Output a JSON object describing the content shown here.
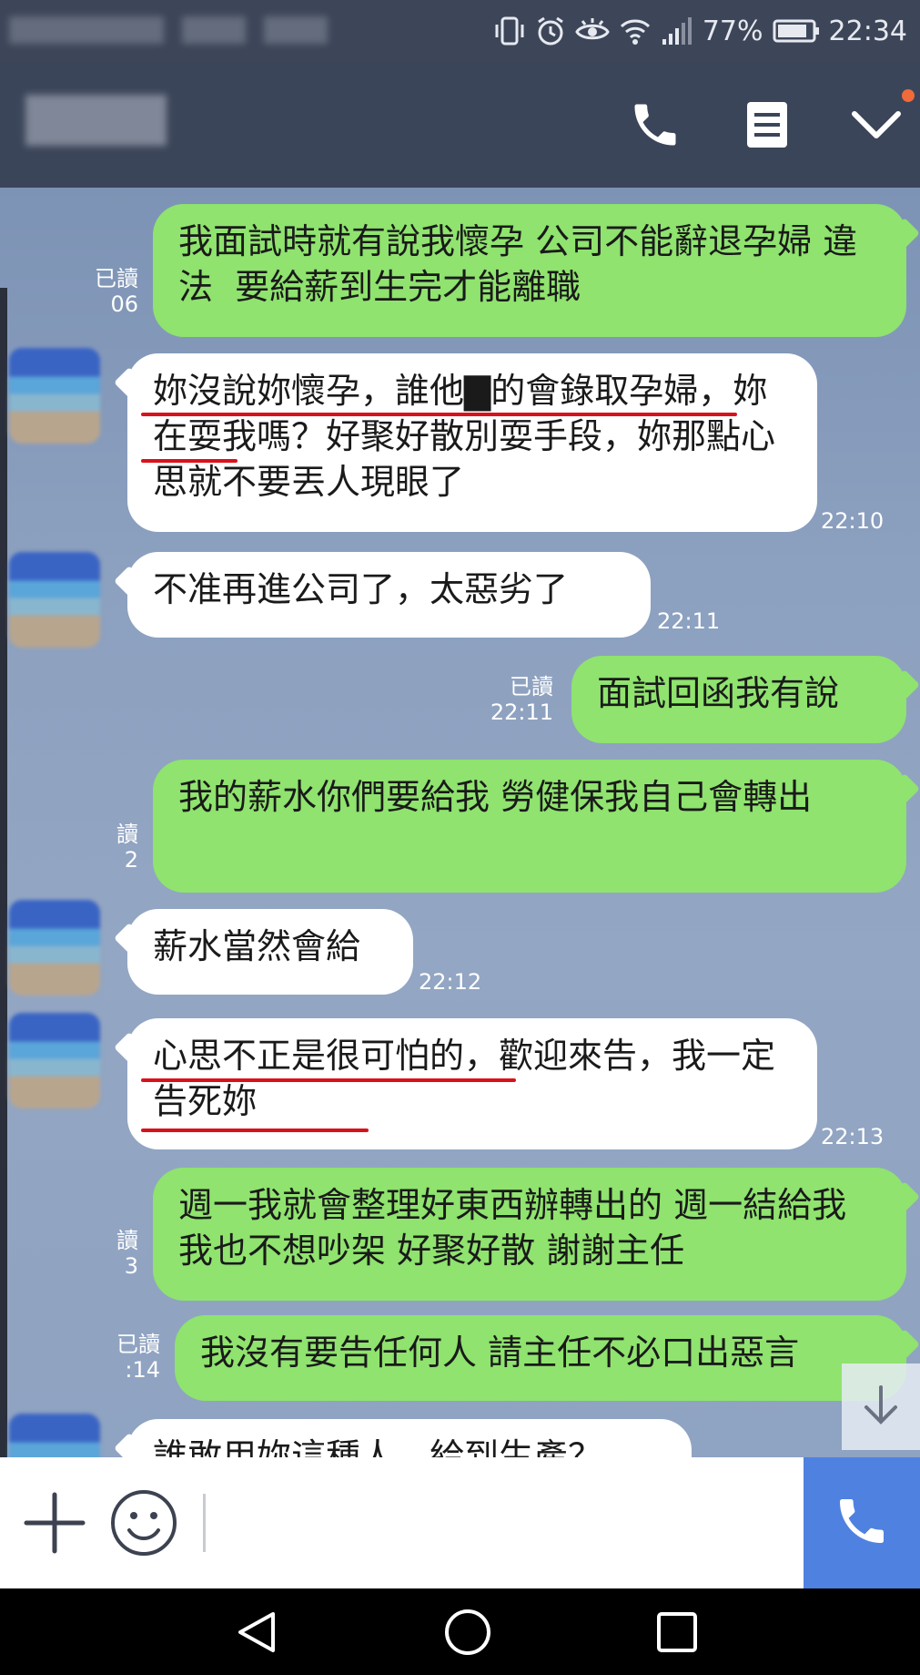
{
  "status_bar": {
    "battery": "77%",
    "time": "22:34",
    "icons": [
      "vibrate-icon",
      "alarm-icon",
      "eye-icon",
      "wifi-icon",
      "signal-icon",
      "battery-icon"
    ]
  },
  "header": {
    "buttons": [
      "phone-icon",
      "notes-icon",
      "chevron-down-icon"
    ]
  },
  "messages": [
    {
      "side": "me",
      "text": "我面試時就有說我懷孕 公司不能辭退孕婦 違法  要給薪到生完才能離職",
      "read": "已讀",
      "time": "06"
    },
    {
      "side": "them",
      "text": "妳沒說妳懷孕，誰他▇的會錄取孕婦，妳在耍我嗎？好聚好散別耍手段，妳那點心思就不要丟人現眼了",
      "time": "22:10"
    },
    {
      "side": "them",
      "text": "不准再進公司了，太惡劣了",
      "time": "22:11"
    },
    {
      "side": "me",
      "text": "面試回函我有說",
      "read": "已讀",
      "time": "22:11"
    },
    {
      "side": "me",
      "text": "我的薪水你們要給我 勞健保我自己會轉出",
      "read": "讀",
      "time": "2"
    },
    {
      "side": "them",
      "text": "薪水當然會給",
      "time": "22:12"
    },
    {
      "side": "them",
      "text": "心思不正是很可怕的，歡迎來告，我一定告死妳",
      "time": "22:13"
    },
    {
      "side": "me",
      "text": "週一我就會整理好東西辦轉出的 週一結給我 我也不想吵架 好聚好散 謝謝主任",
      "read": "讀",
      "time": "3"
    },
    {
      "side": "me",
      "text": "我沒有要告任何人 請主任不必口出惡言",
      "read": "已讀",
      "time": ":14"
    },
    {
      "side": "them",
      "text": "誰敢用妳這種人，給到生產？"
    }
  ],
  "colors": {
    "my_bubble": "#8fe36e",
    "their_bubble": "#ffffff",
    "chat_bg": "#8ca0bf",
    "header_bg": "#3b4559",
    "underline": "#d8121b",
    "call_button": "#4f82e0"
  },
  "input_bar": {
    "icons": [
      "plus-icon",
      "emoji-icon",
      "phone-icon"
    ]
  },
  "nav_bar": {
    "icons": [
      "back-icon",
      "home-icon",
      "recents-icon"
    ]
  }
}
